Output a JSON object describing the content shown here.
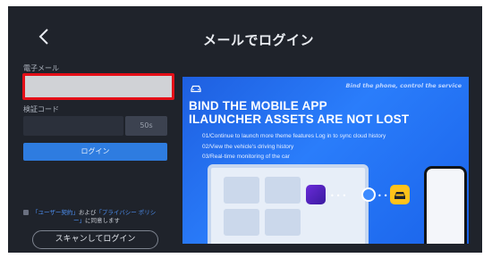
{
  "header": {
    "title": "メールでログイン",
    "back_icon": "chevron-left-icon"
  },
  "form": {
    "email_label": "電子メール",
    "email_value": "",
    "code_label": "検証コード",
    "code_value": "",
    "countdown": "50s",
    "login_button": "ログイン",
    "agreement": {
      "prefix": "",
      "terms_link": "「ユーザー契約」",
      "connector": "および",
      "privacy_link": "「プライバシー ポリシ",
      "privacy_link_cont": "ー」",
      "suffix": "に同意します",
      "checked": true
    },
    "scan_button": "スキャンしてログイン"
  },
  "banner": {
    "tagline": "Bind the phone, control the service",
    "headline_1": "BIND THE MOBILE APP",
    "headline_2": "ILAUNCHER ASSETS ARE NOT LOST",
    "lines": [
      "01/Continue to launch more theme features Log in to sync cloud history",
      "02/View the vehicle's driving history",
      "03/Real-time monitoring of the car"
    ],
    "colors": {
      "accent": "#2a7dfb",
      "highlight": "#e40f18",
      "button": "#2e7ce0"
    }
  }
}
